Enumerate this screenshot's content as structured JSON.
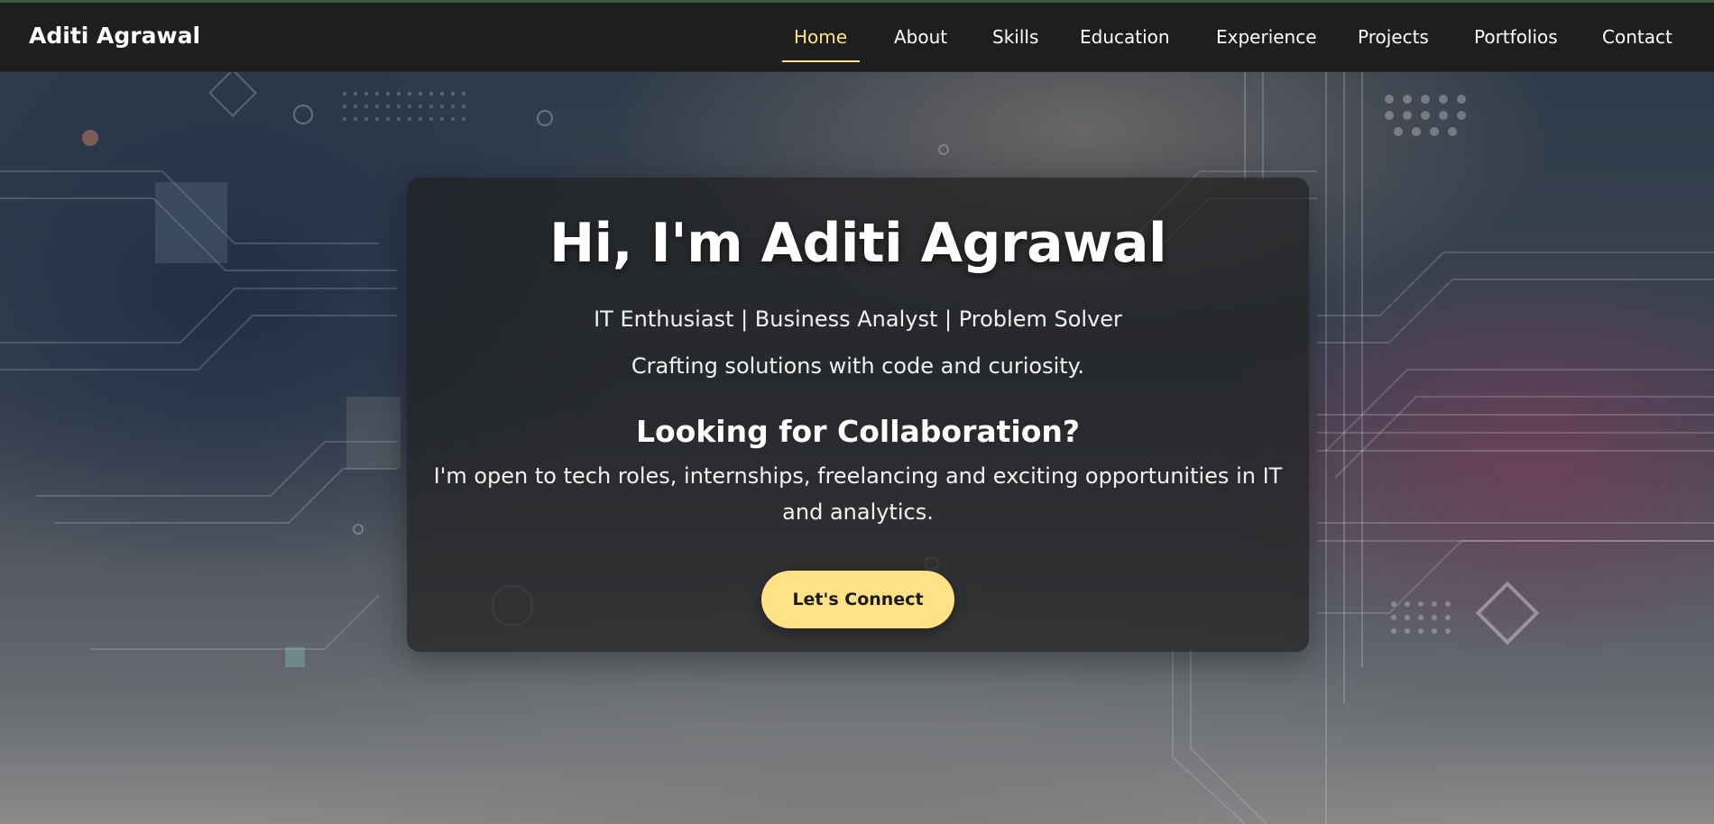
{
  "brand": {
    "name": "Aditi Agrawal"
  },
  "nav": {
    "items": [
      {
        "label": "Home",
        "active": true
      },
      {
        "label": "About"
      },
      {
        "label": "Skills"
      },
      {
        "label": "Education"
      },
      {
        "label": "Experience"
      },
      {
        "label": "Projects"
      },
      {
        "label": "Portfolios"
      },
      {
        "label": "Contact"
      }
    ]
  },
  "hero": {
    "title": "Hi, I'm Aditi Agrawal",
    "tagline": "IT Enthusiast | Business Analyst | Problem Solver",
    "subtagline": "Crafting solutions with code and curiosity.",
    "collab_heading": "Looking for Collaboration?",
    "collab_text": "I'm open to tech roles, internships, freelancing and exciting opportunities in IT and analytics.",
    "cta_label": "Let's Connect"
  },
  "colors": {
    "accent": "#ffe186",
    "navbar_bg": "#1e1e1e",
    "card_bg": "rgba(32,32,32,0.72)"
  }
}
